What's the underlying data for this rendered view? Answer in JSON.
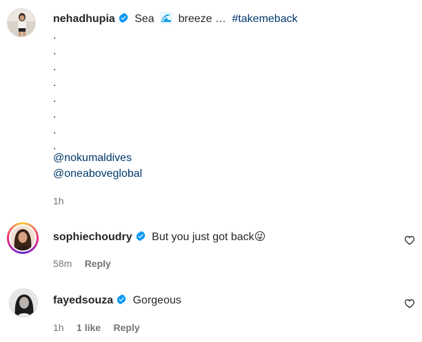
{
  "post": {
    "username": "nehadhupia",
    "caption_parts": [
      "Sea",
      "breeze …"
    ],
    "hashtag": "#takemeback",
    "dot_lines": [
      ".",
      ".",
      ".",
      ".",
      ".",
      ".",
      ".",
      "."
    ],
    "mentions": [
      "@nokumaldives",
      "@oneaboveglobal"
    ],
    "timestamp": "1h"
  },
  "comments": [
    {
      "username": "sophiechoudry",
      "text": "But you just got back",
      "emoji": "😜",
      "timestamp": "58m",
      "reply_label": "Reply"
    },
    {
      "username": "fayedsouza",
      "text": "Gorgeous",
      "timestamp": "1h",
      "likes": "1 like",
      "reply_label": "Reply"
    }
  ],
  "colors": {
    "verified": "#0095f6",
    "link": "#00376b",
    "meta": "#737373",
    "story_ring": [
      "#f9ce34",
      "#ee2a7b",
      "#6228d7"
    ]
  },
  "icons": {
    "verified": "verified-badge-icon",
    "wave": "wave-emoji-icon",
    "heart": "heart-outline-icon"
  }
}
